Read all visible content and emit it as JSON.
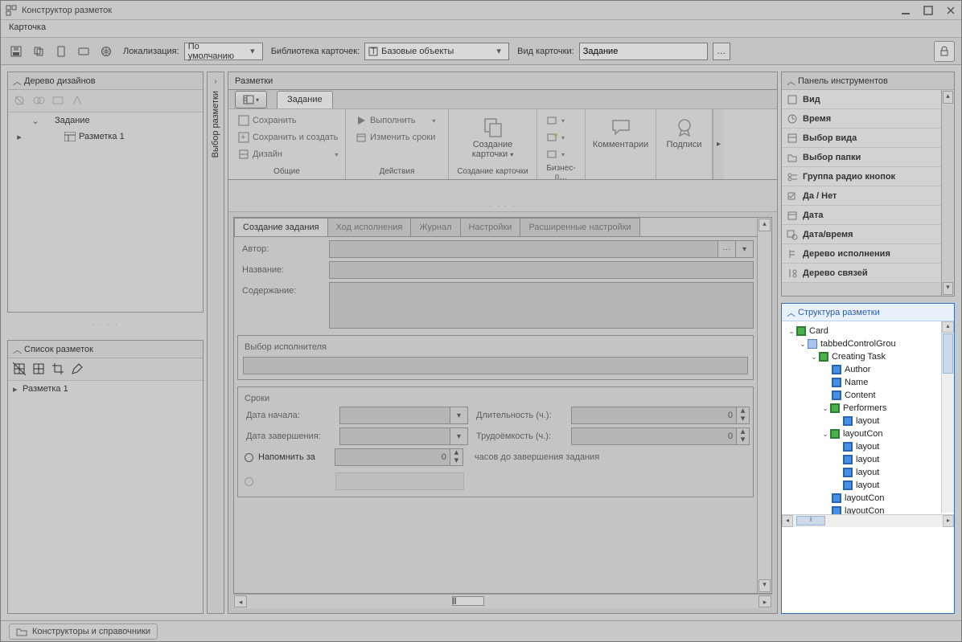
{
  "window": {
    "title": "Конструктор разметок"
  },
  "menu": {
    "card": "Карточка"
  },
  "toolbar": {
    "loc_label": "Локализация:",
    "loc_value": "По умолчанию",
    "lib_label": "Библиотека карточек:",
    "lib_value": "Базовые объекты",
    "kind_label": "Вид карточки:",
    "kind_value": "Задание"
  },
  "left": {
    "tree_title": "Дерево дизайнов",
    "tree_root": "Задание",
    "tree_child": "Разметка 1",
    "list_title": "Список разметок",
    "list_item": "Разметка 1",
    "collapsed_title": "Выбор разметки"
  },
  "center": {
    "title": "Разметки",
    "ribbon_tab": "Задание",
    "group_common": "Общие",
    "btn_save": "Сохранить",
    "btn_save_create": "Сохранить и создать",
    "btn_design": "Дизайн",
    "group_actions": "Действия",
    "btn_execute": "Выполнить",
    "btn_change_dates": "Изменить сроки",
    "group_create": "Создание карточки",
    "btn_create_card": "Создание карточки",
    "group_biz": "Бизнес-п…",
    "group_comments": "Комментарии",
    "group_sign": "Подписи",
    "tabs": {
      "t1": "Создание задания",
      "t2": "Ход исполнения",
      "t3": "Журнал",
      "t4": "Настройки",
      "t5": "Расширенные настройки"
    },
    "fields": {
      "author": "Автор:",
      "name": "Название:",
      "content": "Содержание:",
      "performer_group": "Выбор исполнителя",
      "dates_group": "Сроки",
      "start_date": "Дата начала:",
      "end_date": "Дата завершения:",
      "duration": "Длительность (ч.):",
      "labor": "Трудоёмкость (ч.):",
      "duration_val": "0",
      "labor_val": "0",
      "remind": "Напомнить за",
      "remind_val": "0",
      "remind_suffix": "часов до завершения задания"
    }
  },
  "right": {
    "tools_title": "Панель инструментов",
    "tools": [
      "Вид",
      "Время",
      "Выбор вида",
      "Выбор папки",
      "Группа радио кнопок",
      "Да / Нет",
      "Дата",
      "Дата/время",
      "Дерево исполнения",
      "Дерево связей"
    ],
    "struct_title": "Структура разметки",
    "tree": {
      "card": "Card",
      "tcg": "tabbedControlGrou",
      "ct": "Creating Task",
      "author": "Author",
      "name": "Name",
      "content": "Content",
      "perf": "Performers",
      "layout": "layout",
      "layoutCon": "layoutCon"
    }
  },
  "footer": {
    "tab": "Конструкторы и справочники"
  }
}
